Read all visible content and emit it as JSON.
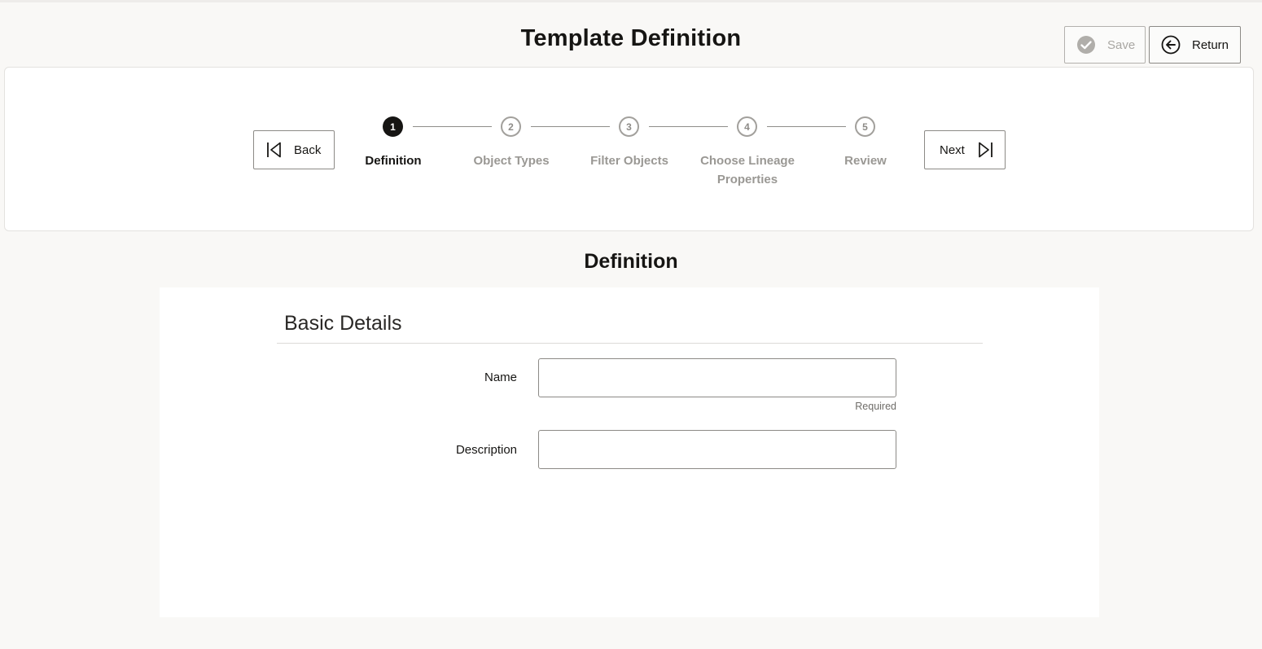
{
  "header": {
    "title": "Template Definition",
    "save_label": "Save",
    "return_label": "Return"
  },
  "train": {
    "back_label": "Back",
    "next_label": "Next",
    "current_step": 1,
    "steps": [
      {
        "number": "1",
        "label": "Definition",
        "state": "active"
      },
      {
        "number": "2",
        "label": "Object Types",
        "state": "pending"
      },
      {
        "number": "3",
        "label": "Filter Objects",
        "state": "pending"
      },
      {
        "number": "4",
        "label": "Choose Lineage Properties",
        "state": "pending"
      },
      {
        "number": "5",
        "label": "Review",
        "state": "pending"
      }
    ]
  },
  "section": {
    "title": "Definition",
    "group_heading": "Basic Details"
  },
  "form": {
    "name": {
      "label": "Name",
      "value": "",
      "helper": "Required"
    },
    "description": {
      "label": "Description",
      "value": ""
    }
  },
  "colors": {
    "background": "#f9f8f6",
    "text": "#161513",
    "pending": "#9a9894",
    "border": "#8c8a86"
  },
  "icons": {
    "save": "check-circle-icon",
    "return": "arrow-left-circle-icon",
    "back": "first-page-icon",
    "next": "last-page-icon"
  }
}
